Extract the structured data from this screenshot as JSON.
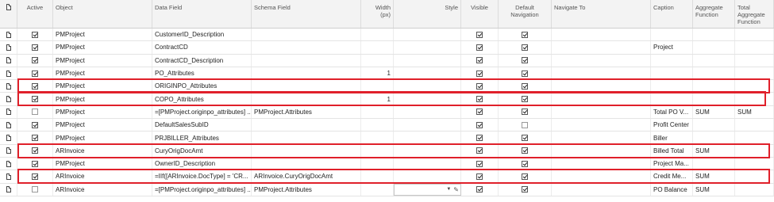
{
  "headers": {
    "icon": "file-icon",
    "active": "Active",
    "object": "Object",
    "data_field": "Data Field",
    "schema_field": "Schema Field",
    "width": "Width (px)",
    "style": "Style",
    "visible": "Visible",
    "default_navigation": "Default Navigation",
    "navigate_to": "Navigate To",
    "caption": "Caption",
    "aggregate_function": "Aggregate Function",
    "total_aggregate_function": "Total Aggregate Function"
  },
  "rows": [
    {
      "active": true,
      "object": "PMProject",
      "data_field": "CustomerID_Description",
      "schema_field": "",
      "width": "",
      "visible": true,
      "default_navigation": true,
      "navigate_to": "",
      "caption": "",
      "aggregate": "",
      "total_aggregate": ""
    },
    {
      "active": true,
      "object": "PMProject",
      "data_field": "ContractCD",
      "schema_field": "",
      "width": "",
      "visible": true,
      "default_navigation": true,
      "navigate_to": "",
      "caption": "Project",
      "aggregate": "",
      "total_aggregate": ""
    },
    {
      "active": true,
      "object": "PMProject",
      "data_field": "ContractCD_Description",
      "schema_field": "",
      "width": "",
      "visible": true,
      "default_navigation": true,
      "navigate_to": "",
      "caption": "",
      "aggregate": "",
      "total_aggregate": ""
    },
    {
      "active": true,
      "object": "PMProject",
      "data_field": "PO_Attributes",
      "schema_field": "",
      "width": "1",
      "visible": true,
      "default_navigation": true,
      "navigate_to": "",
      "caption": "",
      "aggregate": "",
      "total_aggregate": ""
    },
    {
      "active": true,
      "object": "PMProject",
      "data_field": "ORIGINPO_Attributes",
      "schema_field": "",
      "width": "",
      "visible": true,
      "default_navigation": true,
      "navigate_to": "",
      "caption": "",
      "aggregate": "",
      "total_aggregate": ""
    },
    {
      "active": true,
      "object": "PMProject",
      "data_field": "COPO_Attributes",
      "schema_field": "",
      "width": "1",
      "visible": true,
      "default_navigation": true,
      "navigate_to": "",
      "caption": "",
      "aggregate": "",
      "total_aggregate": ""
    },
    {
      "active": false,
      "object": "PMProject",
      "data_field": "=[PMProject.originpo_attributes] ...",
      "schema_field": "PMProject.Attributes",
      "width": "",
      "visible": true,
      "default_navigation": true,
      "navigate_to": "",
      "caption": "Total PO V...",
      "aggregate": "SUM",
      "total_aggregate": "SUM"
    },
    {
      "active": true,
      "object": "PMProject",
      "data_field": "DefaultSalesSubID",
      "schema_field": "",
      "width": "",
      "visible": true,
      "default_navigation": false,
      "navigate_to": "",
      "caption": "Profit Center",
      "aggregate": "",
      "total_aggregate": ""
    },
    {
      "active": true,
      "object": "PMProject",
      "data_field": "PRJBILLER_Attributes",
      "schema_field": "",
      "width": "",
      "visible": true,
      "default_navigation": true,
      "navigate_to": "",
      "caption": "Biller",
      "aggregate": "",
      "total_aggregate": ""
    },
    {
      "active": true,
      "object": "ARInvoice",
      "data_field": "CuryOrigDocAmt",
      "schema_field": "",
      "width": "",
      "visible": true,
      "default_navigation": true,
      "navigate_to": "",
      "caption": "Billed Total",
      "aggregate": "SUM",
      "total_aggregate": ""
    },
    {
      "active": true,
      "object": "PMProject",
      "data_field": "OwnerID_Description",
      "schema_field": "",
      "width": "",
      "visible": true,
      "default_navigation": true,
      "navigate_to": "",
      "caption": "Project Ma...",
      "aggregate": "",
      "total_aggregate": ""
    },
    {
      "active": true,
      "object": "ARInvoice",
      "data_field": "=IIf([ARInvoice.DocType] = 'CR...",
      "schema_field": "ARInvoice.CuryOrigDocAmt",
      "width": "",
      "visible": true,
      "default_navigation": true,
      "navigate_to": "",
      "caption": "Credit Me...",
      "aggregate": "SUM",
      "total_aggregate": ""
    },
    {
      "active": false,
      "object": "ARInvoice",
      "data_field": "=[PMProject.originpo_attributes] ...",
      "schema_field": "PMProject.Attributes",
      "width": "",
      "visible": true,
      "default_navigation": true,
      "navigate_to": "",
      "caption": "PO Balance",
      "aggregate": "SUM",
      "total_aggregate": "",
      "editing_style": true
    }
  ],
  "highlight_color": "#e0202a"
}
